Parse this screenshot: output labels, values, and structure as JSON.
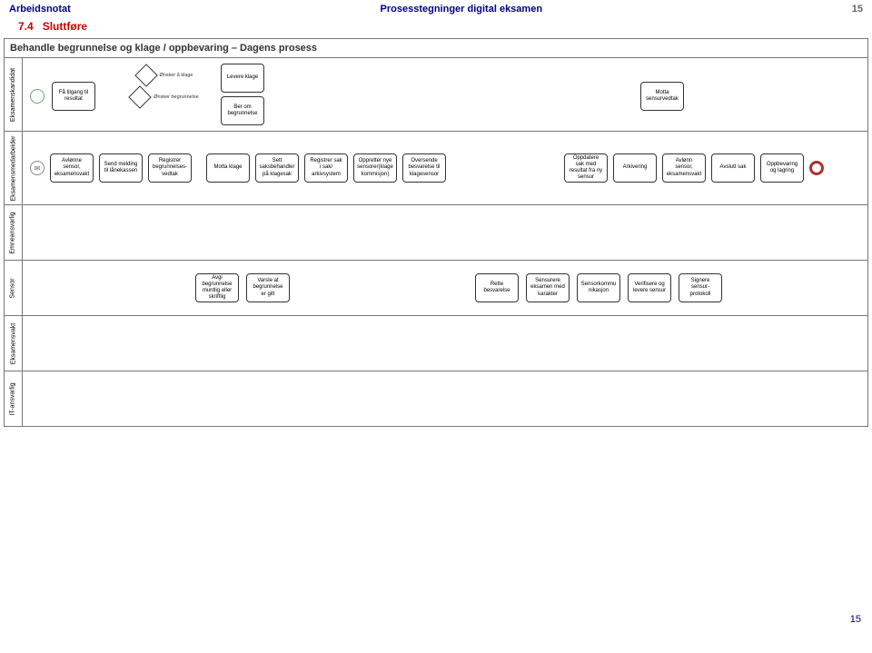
{
  "header": {
    "left": "Arbeidsnotat",
    "center": "Prosesstegninger digital eksamen",
    "right_page": "15"
  },
  "section_num": "7.4",
  "section_title": "Sluttføre",
  "diagram_title": "Behandle begrunnelse og klage / oppbevaring – Dagens prosess",
  "lanes": {
    "kandidat": "Eksamenskandidat",
    "medarbeider": "Eksamensmedarbeider",
    "emneansvarlig": "Emneansvarlig",
    "sensor": "Sensor",
    "eksamensvakt": "Eksamensvakt",
    "itansvarlig": "IT-ansvarlig"
  },
  "kandidat": {
    "fa_tilgang": "Få tilgang til resultat",
    "onsker_klage": "Ønsker å klage",
    "onsker_begrunnelse": "Ønsker begrunnelse",
    "levere_klage": "Levere klage",
    "ber_om": "Ber om begrunnelse",
    "motta": "Motta sensurvedtak"
  },
  "medarbeider": {
    "avlonne": "Avlønne sensor, eksamensvakt",
    "send_melding": "Send melding til lånekassen",
    "registrer": "Registrer begrunnelses-vedtak",
    "motta_klage": "Motta klage",
    "sett_saks": "Sett saksbehandler på klagesak",
    "registrer_sak": "Registrer sak i sak/ arkivsystem",
    "oppretter": "Oppretter nye sensorer(klage kommisjon)",
    "oversende": "Oversende besvarelse til klagesensor",
    "oppdatere": "Oppdatere sak med resultat fra ny sensur",
    "arkivering": "Arkivering",
    "avlonn2": "Avlønn sensor, eksamensvakt",
    "avslutt": "Avslutt sak",
    "oppbevaring": "Oppbevaring og lagring"
  },
  "sensor": {
    "avgi": "Avgi begrunnelse muntlig eller skriftlig",
    "varsle": "Varsle at begrunnelse er gitt",
    "rette": "Rette besvarelse",
    "sensurere": "Sensurere eksamen med karakter",
    "sensorkommu": "Sensorkommu nikasjon",
    "verifisere": "Verifisere og levere sensur",
    "signere": "Signere sensur-protokoll"
  },
  "footer_page": "15"
}
